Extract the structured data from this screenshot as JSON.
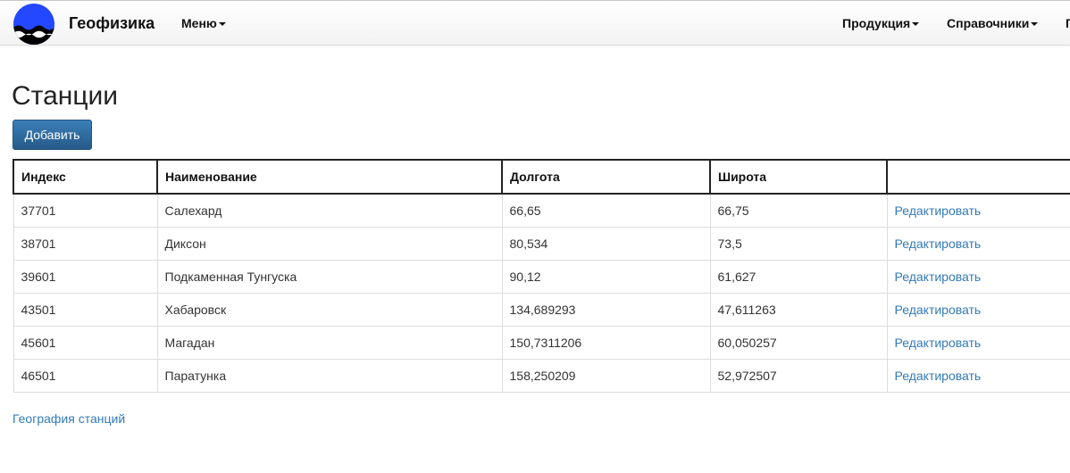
{
  "navbar": {
    "brand": "Геофизика",
    "menu_label": "Меню",
    "products_label": "Продукция",
    "references_label": "Справочники",
    "cut_item_label": "Г"
  },
  "colors": {
    "primary_button": "#286090",
    "link": "#337ab7",
    "logo_blue": "#2448ff",
    "logo_water": "#000000"
  },
  "page": {
    "title": "Станции",
    "add_button": "Добавить",
    "geo_link": "География станций"
  },
  "table": {
    "headers": [
      "Индекс",
      "Наименование",
      "Долгота",
      "Широта",
      ""
    ],
    "rows": [
      {
        "index": "37701",
        "name": "Салехард",
        "lon": "66,65",
        "lat": "66,75",
        "action": "Редактировать"
      },
      {
        "index": "38701",
        "name": "Диксон",
        "lon": "80,534",
        "lat": "73,5",
        "action": "Редактировать"
      },
      {
        "index": "39601",
        "name": "Подкаменная Тунгуска",
        "lon": "90,12",
        "lat": "61,627",
        "action": "Редактировать"
      },
      {
        "index": "43501",
        "name": "Хабаровск",
        "lon": "134,689293",
        "lat": "47,611263",
        "action": "Редактировать"
      },
      {
        "index": "45601",
        "name": "Магадан",
        "lon": "150,7311206",
        "lat": "60,050257",
        "action": "Редактировать"
      },
      {
        "index": "46501",
        "name": "Паратунка",
        "lon": "158,250209",
        "lat": "52,972507",
        "action": "Редактировать"
      }
    ]
  }
}
